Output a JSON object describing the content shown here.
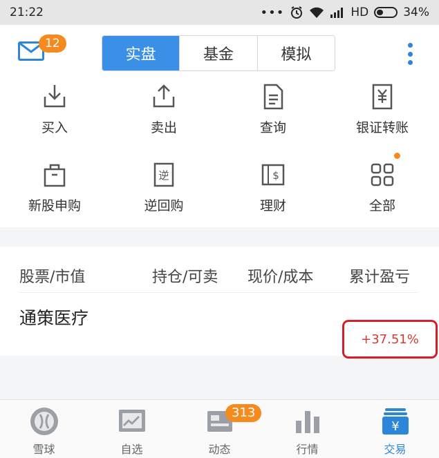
{
  "status_bar": {
    "time": "21:22",
    "network": "HD",
    "battery": "34%"
  },
  "header": {
    "mail_badge": "12",
    "tabs": [
      {
        "label": "实盘",
        "active": true
      },
      {
        "label": "基金",
        "active": false
      },
      {
        "label": "模拟",
        "active": false
      }
    ]
  },
  "actions": [
    {
      "label": "买入",
      "icon": "buy-icon"
    },
    {
      "label": "卖出",
      "icon": "sell-icon"
    },
    {
      "label": "查询",
      "icon": "query-icon"
    },
    {
      "label": "银证转账",
      "icon": "bank-transfer-icon"
    },
    {
      "label": "新股申购",
      "icon": "ipo-bag-icon"
    },
    {
      "label": "逆回购",
      "icon": "reverse-repo-icon"
    },
    {
      "label": "理财",
      "icon": "wealth-icon"
    },
    {
      "label": "全部",
      "icon": "all-grid-icon"
    }
  ],
  "table": {
    "headers": [
      "股票/市值",
      "持仓/可卖",
      "现价/成本",
      "累计盈亏"
    ],
    "rows": [
      {
        "name": "通策医疗",
        "profit": "+37.51%"
      }
    ]
  },
  "tabbar": {
    "items": [
      {
        "label": "雪球",
        "icon": "snowball-icon",
        "active": false
      },
      {
        "label": "自选",
        "icon": "watchlist-icon",
        "active": false
      },
      {
        "label": "动态",
        "icon": "feed-icon",
        "active": false,
        "badge": "313"
      },
      {
        "label": "行情",
        "icon": "market-icon",
        "active": false
      },
      {
        "label": "交易",
        "icon": "trade-icon",
        "active": true
      }
    ]
  },
  "colors": {
    "accent": "#3a8fe6",
    "badge": "#f58a1f",
    "profit": "#d23b31",
    "highlight_box": "#d21f2a"
  }
}
